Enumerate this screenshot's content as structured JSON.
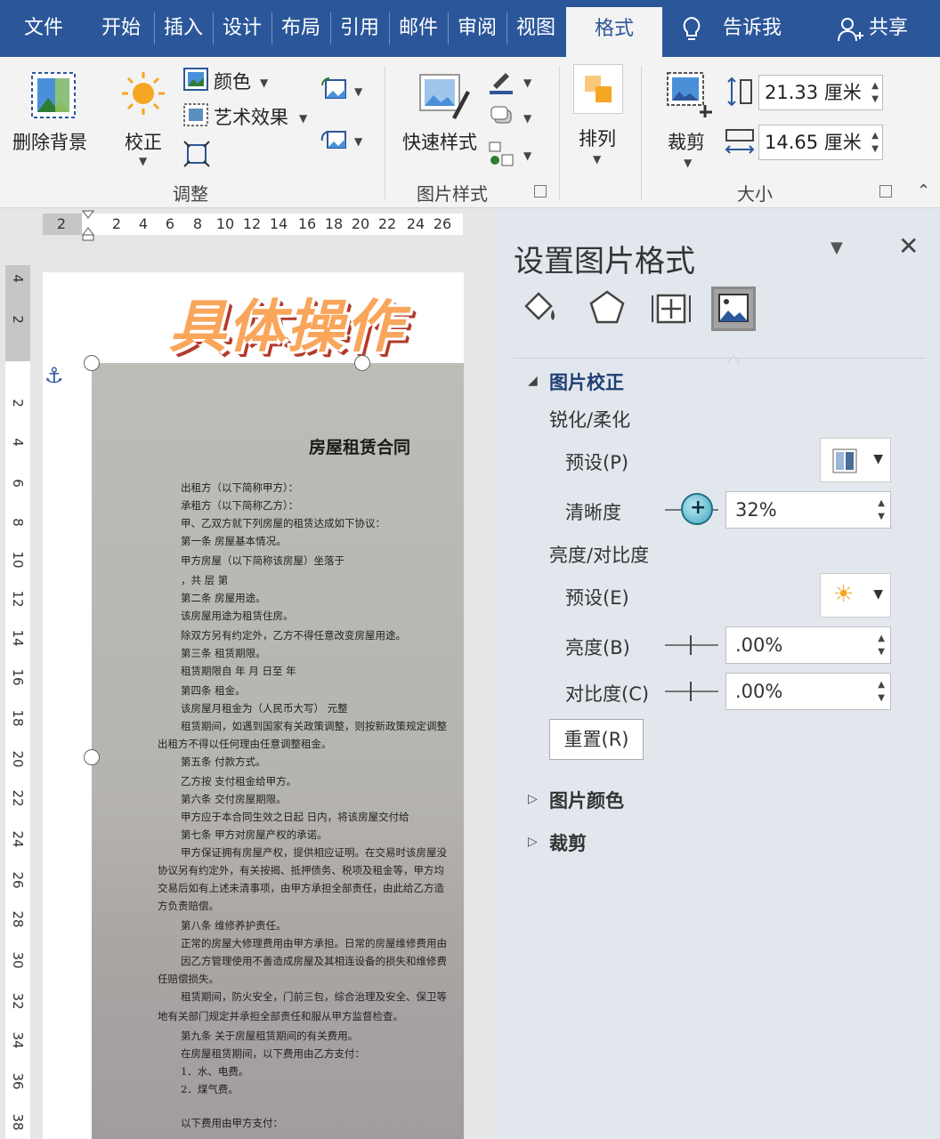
{
  "tabs": [
    {
      "label": "文件"
    },
    {
      "label": "开始"
    },
    {
      "label": "插入"
    },
    {
      "label": "设计"
    },
    {
      "label": "布局"
    },
    {
      "label": "引用"
    },
    {
      "label": "邮件"
    },
    {
      "label": "审阅"
    },
    {
      "label": "视图"
    },
    {
      "label": "格式"
    }
  ],
  "tab_extras": {
    "tell_me": "告诉我",
    "share": "共享"
  },
  "ribbon": {
    "remove_bg": "删除背景",
    "correct": "校正",
    "color": "颜色",
    "art_effects": "艺术效果",
    "adjust_group": "调整",
    "quick_styles": "快速样式",
    "pic_styles_group": "图片样式",
    "arrange": "排列",
    "crop": "裁剪",
    "height_value": "21.33 厘米",
    "width_value": "14.65 厘米",
    "size_group": "大小"
  },
  "ruler_h": [
    "2",
    "2",
    "4",
    "6",
    "8",
    "10",
    "12",
    "14",
    "16",
    "18",
    "20",
    "22",
    "24",
    "26"
  ],
  "ruler_v": [
    "4",
    "2",
    "2",
    "4",
    "6",
    "8",
    "10",
    "12",
    "14",
    "16",
    "18",
    "20",
    "22",
    "24",
    "26",
    "28",
    "30",
    "32",
    "34",
    "36",
    "38"
  ],
  "document": {
    "banner": "具体操作",
    "contract_title": "房屋租赁合同",
    "lines": [
      "出租方（以下简称甲方）：",
      "承租方（以下简称乙方）：",
      "甲、乙双方就下列房屋的租赁达成如下协议：",
      "第一条  房屋基本情况。",
      "甲方房屋（以下简称该房屋）坐落于",
      "，共        层 第",
      "第二条  房屋用途。",
      "该房屋用途为租赁住房。",
      "除双方另有约定外，乙方不得任意改变房屋用途。",
      "第三条  租赁期限。",
      "租赁期限自       年       月       日至       年",
      "第四条  租金。",
      "该房屋月租金为（人民币大写）                              元整",
      "租赁期间，如遇到国家有关政策调整，则按新政策规定调整",
      "出租方不得以任何理由任意调整租金。",
      "第五条  付款方式。",
      "乙方按         支付租金给甲方。",
      "第六条  交付房屋期限。",
      "甲方应于本合同生效之日起          日内，将该房屋交付给",
      "第七条  甲方对房屋产权的承诺。",
      "甲方保证拥有房屋产权，提供相应证明。在交易时该房屋没",
      "协议另有约定外，有关按揭、抵押债务、税项及租金等，甲方均",
      "交易后如有上述未清事项，由甲方承担全部责任，由此给乙方造",
      "方负责赔偿。",
      "第八条  维修养护责任。",
      "正常的房屋大修理费用由甲方承担。日常的房屋维修费用由",
      "因乙方管理使用不善造成房屋及其相连设备的损失和维修费",
      "任赔偿损失。",
      "租赁期间，防火安全，门前三包，综合治理及安全、保卫等",
      "地有关部门规定并承担全部责任和服从甲方监督检查。",
      "第九条  关于房屋租赁期间的有关费用。",
      "在房屋租赁期间，以下费用由乙方支付：",
      "1．水、电费。",
      "2．煤气费。",
      "以下费用由甲方支付："
    ]
  },
  "pane": {
    "title": "设置图片格式",
    "section_correction": "图片校正",
    "sub_sharpen": "锐化/柔化",
    "preset_p": "预设(P)",
    "clarity_label": "清晰度",
    "clarity_value": "32%",
    "sub_brightness": "亮度/对比度",
    "preset_e": "预设(E)",
    "brightness_label": "亮度(B)",
    "brightness_value": ".00%",
    "contrast_label": "对比度(C)",
    "contrast_value": ".00%",
    "reset": "重置(R)",
    "section_color": "图片颜色",
    "section_crop": "裁剪"
  },
  "colors": {
    "accent": "#2b579a",
    "ribbon_bg": "#f3f3f3",
    "pane_bg": "#e2e7ed"
  }
}
